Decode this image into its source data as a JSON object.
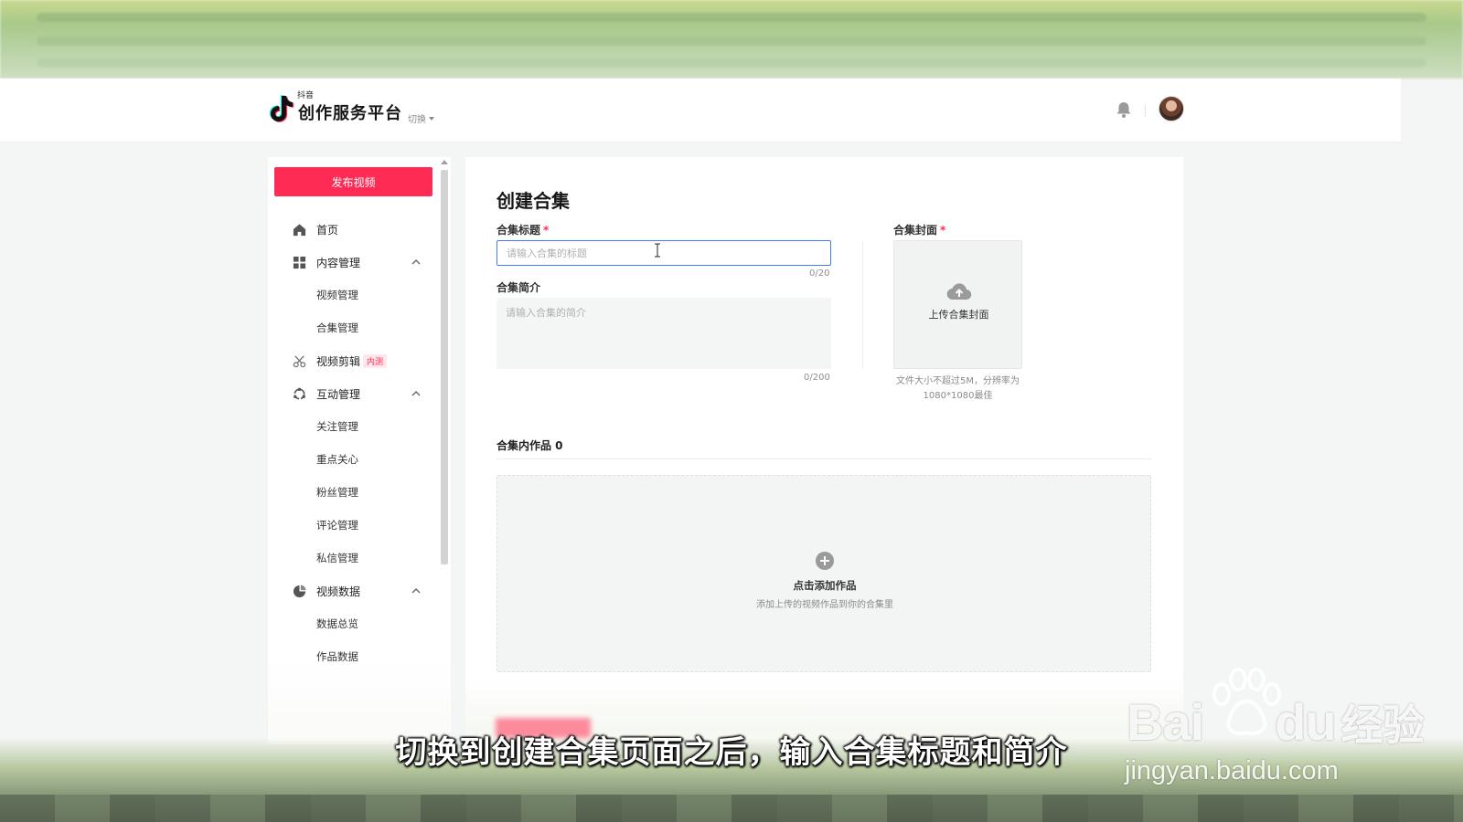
{
  "header": {
    "logo_small": "抖音",
    "logo_main": "创作服务平台",
    "switch_label": "切换"
  },
  "sidebar": {
    "publish_label": "发布视频",
    "items": [
      {
        "label": "首页"
      },
      {
        "label": "内容管理"
      },
      {
        "label": "视频管理"
      },
      {
        "label": "合集管理"
      },
      {
        "label": "视频剪辑",
        "badge": "内测"
      },
      {
        "label": "互动管理"
      },
      {
        "label": "关注管理"
      },
      {
        "label": "重点关心"
      },
      {
        "label": "粉丝管理"
      },
      {
        "label": "评论管理"
      },
      {
        "label": "私信管理"
      },
      {
        "label": "视频数据"
      },
      {
        "label": "数据总览"
      },
      {
        "label": "作品数据"
      }
    ]
  },
  "form": {
    "page_title": "创建合集",
    "title_label": "合集标题",
    "title_placeholder": "请输入合集的标题",
    "title_value": "",
    "title_counter": "0/20",
    "intro_label": "合集简介",
    "intro_placeholder": "请输入合集的简介",
    "intro_value": "",
    "intro_counter": "0/200",
    "cover_label": "合集封面",
    "cover_upload_label": "上传合集封面",
    "cover_hint_line1": "文件大小不超过5M，分辨率为",
    "cover_hint_line2": "1080*1080最佳",
    "works_label": "合集内作品 0",
    "add_label": "点击添加作品",
    "add_sub": "添加上传的视频作品到你的合集里",
    "required_mark": "*"
  },
  "caption": "切换到创建合集页面之后，输入合集标题和简介",
  "watermark": {
    "brand_latin": "Bai",
    "brand_du": "du",
    "brand_cn": "经验",
    "url": "jingyan.baidu.com"
  },
  "colors": {
    "accent": "#fe2c55",
    "focus_border": "#3b7ef2"
  }
}
